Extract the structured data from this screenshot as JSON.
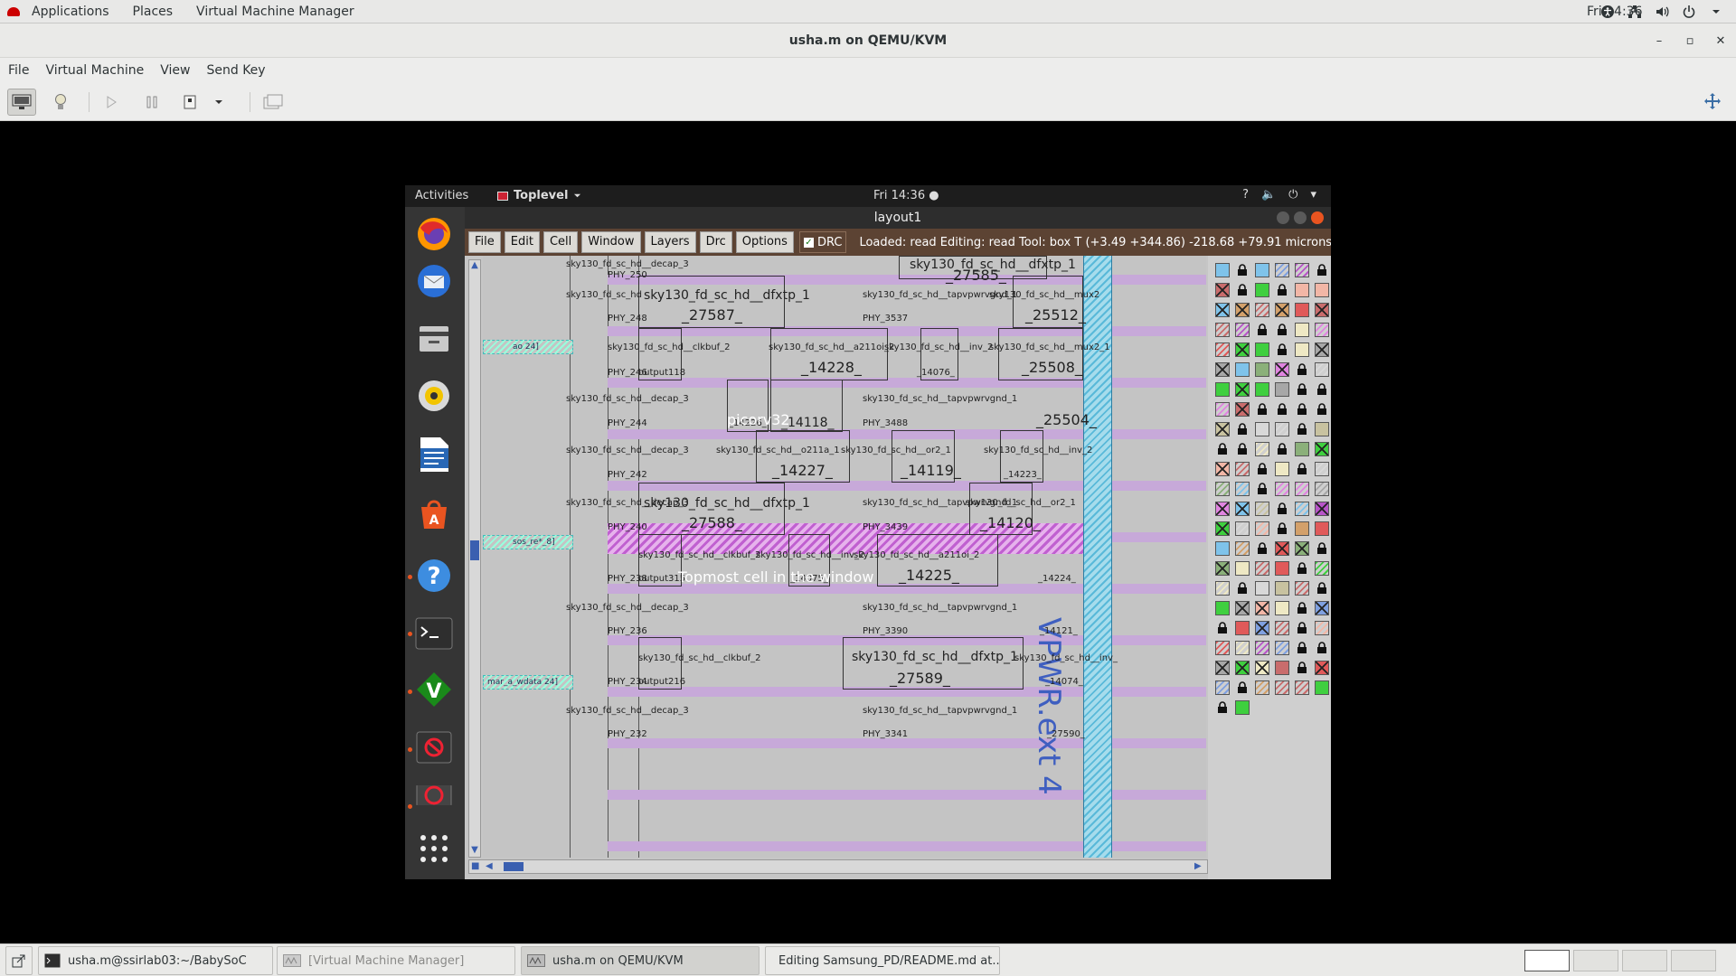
{
  "host": {
    "top_menu": [
      "Applications",
      "Places",
      "Virtual Machine Manager"
    ],
    "clock": "Fri 14:36"
  },
  "vmm": {
    "title": "usha.m on QEMU/KVM",
    "menu": [
      "File",
      "Virtual Machine",
      "View",
      "Send Key"
    ]
  },
  "guest": {
    "activities": "Activities",
    "toplevel": "Toplevel",
    "clock": "Fri 14:36 ●"
  },
  "magic": {
    "window_title": "layout1",
    "menu": [
      "File",
      "Edit",
      "Cell",
      "Window",
      "Layers",
      "Drc",
      "Options"
    ],
    "drc_label": "DRC",
    "status": "Loaded: read Editing: read Tool: box  T    (+3.49 +344.86) -218.68 +79.91 microns"
  },
  "layout": {
    "cells": [
      {
        "t": "sky130_fd_sc_hd__decap_3"
      },
      {
        "t": "PHY_250"
      },
      {
        "t": "sky130_fd_sc_hd__dfxtp_1"
      },
      {
        "t": "_27585_"
      },
      {
        "t": "sky130_fd_sc_hd"
      },
      {
        "t": "sky130_fd_sc_hd__dfxtp_1"
      },
      {
        "t": "_27587_"
      },
      {
        "t": "PHY_248"
      },
      {
        "t": "sky130_fd_sc_hd__tapvpwrvgnd_1"
      },
      {
        "t": "PHY_3537"
      },
      {
        "t": "sky130_fd_sc_hd__mux2"
      },
      {
        "t": "_25512_"
      },
      {
        "t": "sky130_fd_sc_hd__clkbuf_2"
      },
      {
        "t": "PHY_246"
      },
      {
        "t": "output118"
      },
      {
        "t": "sky130_fd_sc_hd__a211oi_2"
      },
      {
        "t": "_14228_"
      },
      {
        "t": "sky130_fd_sc_hd__inv_2"
      },
      {
        "t": "_14076_"
      },
      {
        "t": "sky130_fd_sc_hd__mux2_1"
      },
      {
        "t": "_25508_"
      },
      {
        "t": "sky130_fd_sc_hd__decap_3"
      },
      {
        "t": "PHY_244"
      },
      {
        "t": "_14226_"
      },
      {
        "t": "_14118_"
      },
      {
        "t": "sky130_fd_sc_hd__tapvpwrvgnd_1"
      },
      {
        "t": "PHY_3488"
      },
      {
        "t": "_25504_"
      },
      {
        "t": "sky130_fd_sc_hd__decap_3"
      },
      {
        "t": "PHY_242"
      },
      {
        "t": "sky130_fd_sc_hd__o211a_1"
      },
      {
        "t": "_14227_"
      },
      {
        "t": "sky130_fd_sc_hd__or2_1"
      },
      {
        "t": "_14119_"
      },
      {
        "t": "sky130_fd_sc_hd__inv_2"
      },
      {
        "t": "_14223_"
      },
      {
        "t": "sky130_fd_sc_hd__decap_3"
      },
      {
        "t": "PHY_240"
      },
      {
        "t": "sky130_fd_sc_hd__dfxtp_1"
      },
      {
        "t": "_27588_"
      },
      {
        "t": "sky130_fd_sc_hd__tapvpwrvgnd_1"
      },
      {
        "t": "PHY_3439"
      },
      {
        "t": "sky130_fd_sc_hd__or2_1"
      },
      {
        "t": "_14120_"
      },
      {
        "t": "sky130_fd_sc_hd__clkbuf_2"
      },
      {
        "t": "PHY_238"
      },
      {
        "t": "output315"
      },
      {
        "t": "sky130_fd_sc_hd__inv_2"
      },
      {
        "t": "_14075_"
      },
      {
        "t": "sky130_fd_sc_hd__a211oi_2"
      },
      {
        "t": "_14225_"
      },
      {
        "t": "_14224_"
      },
      {
        "t": "sky130_fd_sc_hd__decap_3"
      },
      {
        "t": "PHY_236"
      },
      {
        "t": "sky130_fd_sc_hd__tapvpwrvgnd_1"
      },
      {
        "t": "PHY_3390"
      },
      {
        "t": "_14121_"
      },
      {
        "t": "sky130_fd_sc_hd__clkbuf_2"
      },
      {
        "t": "PHY_234"
      },
      {
        "t": "output216"
      },
      {
        "t": "sky130_fd_sc_hd__dfxtp_1"
      },
      {
        "t": "_27589_"
      },
      {
        "t": "sky130_fd_sc_hd__inv_"
      },
      {
        "t": "_14074_"
      },
      {
        "t": "sky130_fd_sc_hd__decap_3"
      },
      {
        "t": "PHY_232"
      },
      {
        "t": "sky130_fd_sc_hd__tapvpwrvgnd_1"
      },
      {
        "t": "PHY_3341"
      },
      {
        "t": "_27590_"
      }
    ],
    "pins": [
      "ao 24]",
      "sos_re*_8]",
      "mar_a_wdata 24]"
    ],
    "overlay_1": "picorv32",
    "overlay_2": "Topmost cell in the window",
    "vpwr_label": "VPWR.ext 4"
  },
  "taskbar": [
    {
      "label": "usha.m@ssirlab03:~/BabySoC"
    },
    {
      "label": "[Virtual Machine Manager]"
    },
    {
      "label": "usha.m on QEMU/KVM"
    },
    {
      "label": "Editing Samsung_PD/README.md at..."
    }
  ]
}
